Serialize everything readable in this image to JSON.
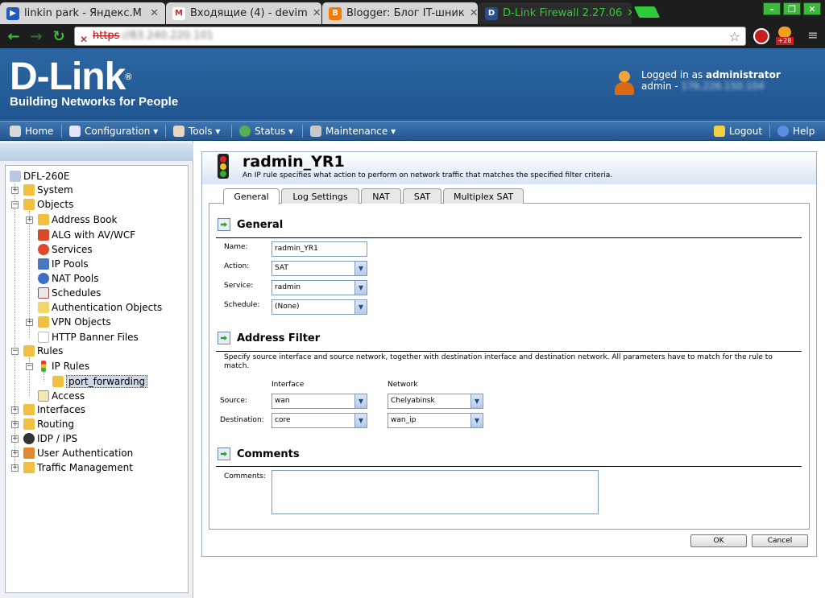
{
  "browser": {
    "tabs": [
      {
        "title": "linkin park - Яндекс.М",
        "color": "#1e5bbf"
      },
      {
        "title": "Входящие (4) - devim",
        "color": "#c0302a"
      },
      {
        "title": "Blogger: Блог IT-шник",
        "color": "#f57c00"
      },
      {
        "title": "D-Link Firewall 2.27.06",
        "color": "#2a4f8a"
      }
    ],
    "url_protocol": "https",
    "url_rest": "://83.240.220.101",
    "addon_badge": "+28"
  },
  "header": {
    "logo": "D-Link",
    "logo_mark": "®",
    "tagline": "Building Networks for People",
    "logged_in_prefix": "Logged in as ",
    "user": "administrator",
    "user_line_prefix": "admin - ",
    "user_ip": "176.226.150.104"
  },
  "menu": {
    "home": "Home",
    "configuration": "Configuration",
    "tools": "Tools",
    "status": "Status",
    "maintenance": "Maintenance",
    "logout": "Logout",
    "help": "Help"
  },
  "tree": {
    "root": "DFL-260E",
    "system": "System",
    "objects": "Objects",
    "address_book": "Address Book",
    "alg": "ALG with AV/WCF",
    "services": "Services",
    "ip_pools": "IP Pools",
    "nat_pools": "NAT Pools",
    "schedules": "Schedules",
    "auth_objects": "Authentication Objects",
    "vpn_objects": "VPN Objects",
    "http_banner": "HTTP Banner Files",
    "rules": "Rules",
    "ip_rules": "IP Rules",
    "port_forwarding": "port_forwarding",
    "access": "Access",
    "interfaces": "Interfaces",
    "routing": "Routing",
    "idp_ips": "IDP / IPS",
    "user_auth": "User Authentication",
    "traffic_mgmt": "Traffic Management"
  },
  "rule": {
    "title": "radmin_YR1",
    "subtitle": "An IP rule specifies what action to perform on network traffic that matches the specified filter criteria.",
    "tabs": [
      "General",
      "Log Settings",
      "NAT",
      "SAT",
      "Multiplex SAT"
    ],
    "active_tab": "General",
    "general": {
      "heading": "General",
      "name_label": "Name:",
      "name_value": "radmin_YR1",
      "action_label": "Action:",
      "action_value": "SAT",
      "service_label": "Service:",
      "service_value": "radmin",
      "schedule_label": "Schedule:",
      "schedule_value": "(None)"
    },
    "address_filter": {
      "heading": "Address Filter",
      "description": "Specify source interface and source network, together with destination interface and destination network. All parameters have to match for the rule to match.",
      "col_interface": "Interface",
      "col_network": "Network",
      "source_label": "Source:",
      "source_interface": "wan",
      "source_network": "Chelyabinsk",
      "dest_label": "Destination:",
      "dest_interface": "core",
      "dest_network": "wan_ip"
    },
    "comments": {
      "heading": "Comments",
      "label": "Comments:",
      "value": ""
    },
    "ok": "OK",
    "cancel": "Cancel"
  }
}
